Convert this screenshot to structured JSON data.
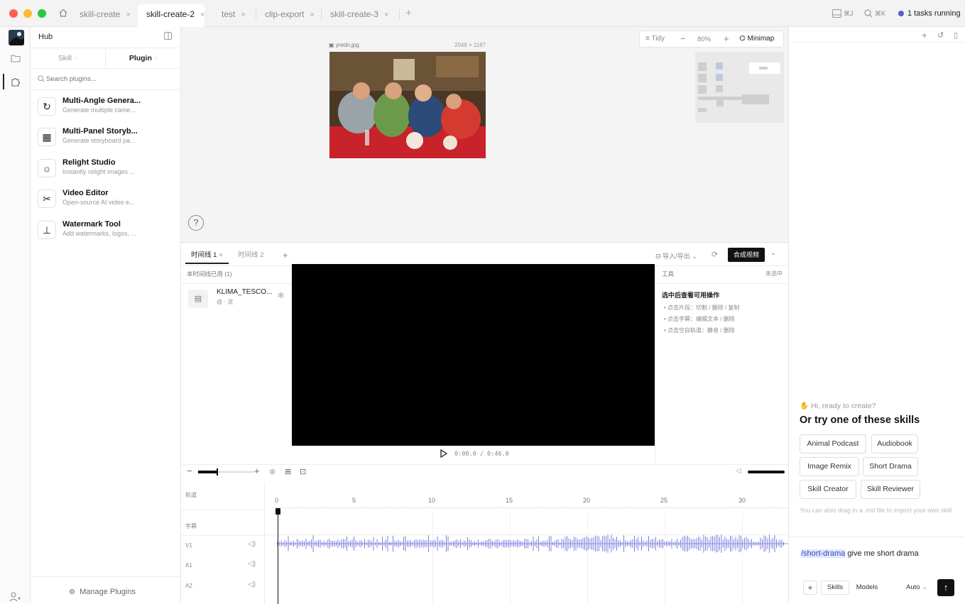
{
  "window": {
    "tabs": [
      {
        "label": "skill-create",
        "close": "×"
      },
      {
        "label": "skill-create-2",
        "close": "×"
      },
      {
        "label": "test",
        "close": "×"
      },
      {
        "label": "clip-export",
        "close": "×"
      },
      {
        "label": "skill-create-3",
        "close": "×"
      }
    ],
    "new_tab": "+",
    "shortcut1": "⌘J",
    "shortcut2": "⌘K",
    "tasks": "1 tasks running",
    "colors": {
      "close": "#ff5f57",
      "min": "#febc2e",
      "max": "#28c840",
      "accent": "#5b5bd6"
    }
  },
  "rail": {
    "icons": [
      "app-logo",
      "folder-icon",
      "puzzle-icon",
      "user-add-icon"
    ]
  },
  "hub": {
    "title": "Hub",
    "tab_skill": "Skill",
    "tab_plugin": "Plugin",
    "search_placeholder": "Search plugins...",
    "plugins": [
      {
        "name": "Multi-Angle Genera...",
        "desc": "Generate multiple came...",
        "icon": "↻"
      },
      {
        "name": "Multi-Panel Storyb...",
        "desc": "Generate storyboard pa...",
        "icon": "▦"
      },
      {
        "name": "Relight Studio",
        "desc": "Instantly relight images ...",
        "icon": "☼"
      },
      {
        "name": "Video Editor",
        "desc": "Open-source AI video e...",
        "icon": "✂"
      },
      {
        "name": "Watermark Tool",
        "desc": "Add watermarks, logos, ...",
        "icon": "⊥"
      }
    ],
    "manage": "Manage Plugins"
  },
  "canvas": {
    "image_name": "yredn.jpg",
    "image_size": "2048 × 1187",
    "tidy": "Tidy",
    "zoom": "80%",
    "minimap": "Minimap",
    "help": "?"
  },
  "editor": {
    "tabs": [
      "时间线 1",
      "时间线 2"
    ],
    "add_tab": "+",
    "import_export": "导入/导出",
    "compose": "合成视频",
    "assets_header": "本时间线已用 (1)",
    "asset_name": "KLIMA_TESCO...",
    "asset_meta": "@ · 次",
    "timecode": "0:00.0 / 0:46.0",
    "tools_label": "工具",
    "tools_right": "未选中",
    "tools_title": "选中后查看可用操作",
    "tools_items": [
      "点击片段：切割 / 删除 / 复制",
      "点击字幕：编辑文本 / 删除",
      "点击空白轨道：静音 / 删除"
    ],
    "track_labels": [
      "轨道",
      "字幕",
      "V1",
      "A1",
      "A2"
    ],
    "ruler": [
      "0",
      "5",
      "10",
      "15",
      "20",
      "25",
      "30"
    ]
  },
  "assistant": {
    "greeting": "Hi, ready to create?",
    "heading": "Or try one of these skills",
    "skills": [
      "Animal Podcast",
      "Audiobook",
      "Image Remix",
      "Short Drama",
      "Skill Creator",
      "Skill Reviewer"
    ],
    "hint": "You can also drag in a .md file to import your own skill",
    "prompt_cmd": "/short-drama",
    "prompt_text": " give me short drama",
    "add": "+",
    "skills_btn": "Skills",
    "models_btn": "Models",
    "auto": "Auto"
  }
}
